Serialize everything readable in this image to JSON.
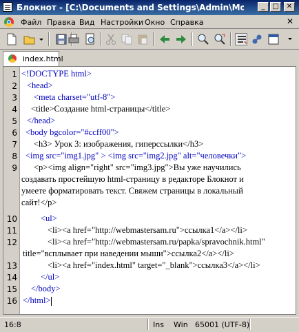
{
  "window": {
    "title": "Блокнот - [C:\\Documents and Settings\\Admin\\Мои докум..."
  },
  "menu": {
    "items": [
      "Файл",
      "Правка",
      "Вид",
      "Настройки",
      "Окно",
      "Справка"
    ]
  },
  "toolbar": {
    "buttons": [
      "new-icon",
      "open-icon",
      "print-icon",
      "print-preview-icon",
      "cut-icon",
      "copy-icon",
      "paste-icon",
      "undo-icon",
      "back-arrow-icon",
      "forward-arrow-icon",
      "find-icon",
      "replace-icon",
      "word-wrap-icon",
      "settings-icon",
      "fullscreen-icon"
    ]
  },
  "tab": {
    "label": "index.html"
  },
  "editor": {
    "line_numbers": [
      "1",
      "2",
      "3",
      "4",
      "5",
      "6",
      "7",
      "8",
      "9",
      "10",
      "11",
      "12",
      "13",
      "14",
      "15",
      "16"
    ],
    "lines": [
      "<!DOCTYPE html>",
      "<head>",
      "<meta charset=\"utf-8\">",
      "<title>Создание  html-страницы</title>",
      "</head>",
      "<body bgcolor=\"#ccff00\">",
      "<h3> Урок 3: изображения, гиперссылки</h3>",
      "<img src=\"img1.jpg\" > <img src=\"img2.jpg\" alt=\"человечки\">",
      "<p><img align=\"right\" src=\"img3.jpg\">Вы уже научились",
      "создавать простейшую html-страницу в редакторе Блокнот и",
      "умеете форматировать текст. Свяжем страницы в локальный",
      "сайт!</p>",
      "<ul>",
      "<li><a href=\"http://webmastersam.ru\">ссылка1</a></li>",
      "<li><a href=\"http://webmastersam.ru/papka/spravochnik.html\"",
      "title=\"всплывает при наведении мыши\">ссылка2</a></li>",
      "<li><a href=\"index.html\" target=\"_blank\">ссылка3</a></li>",
      "</ul>",
      "</body>",
      "</html>"
    ]
  },
  "status": {
    "position": "16:8",
    "mode": "Ins",
    "eol": "Win",
    "encoding": "65001 (UTF-8)"
  }
}
